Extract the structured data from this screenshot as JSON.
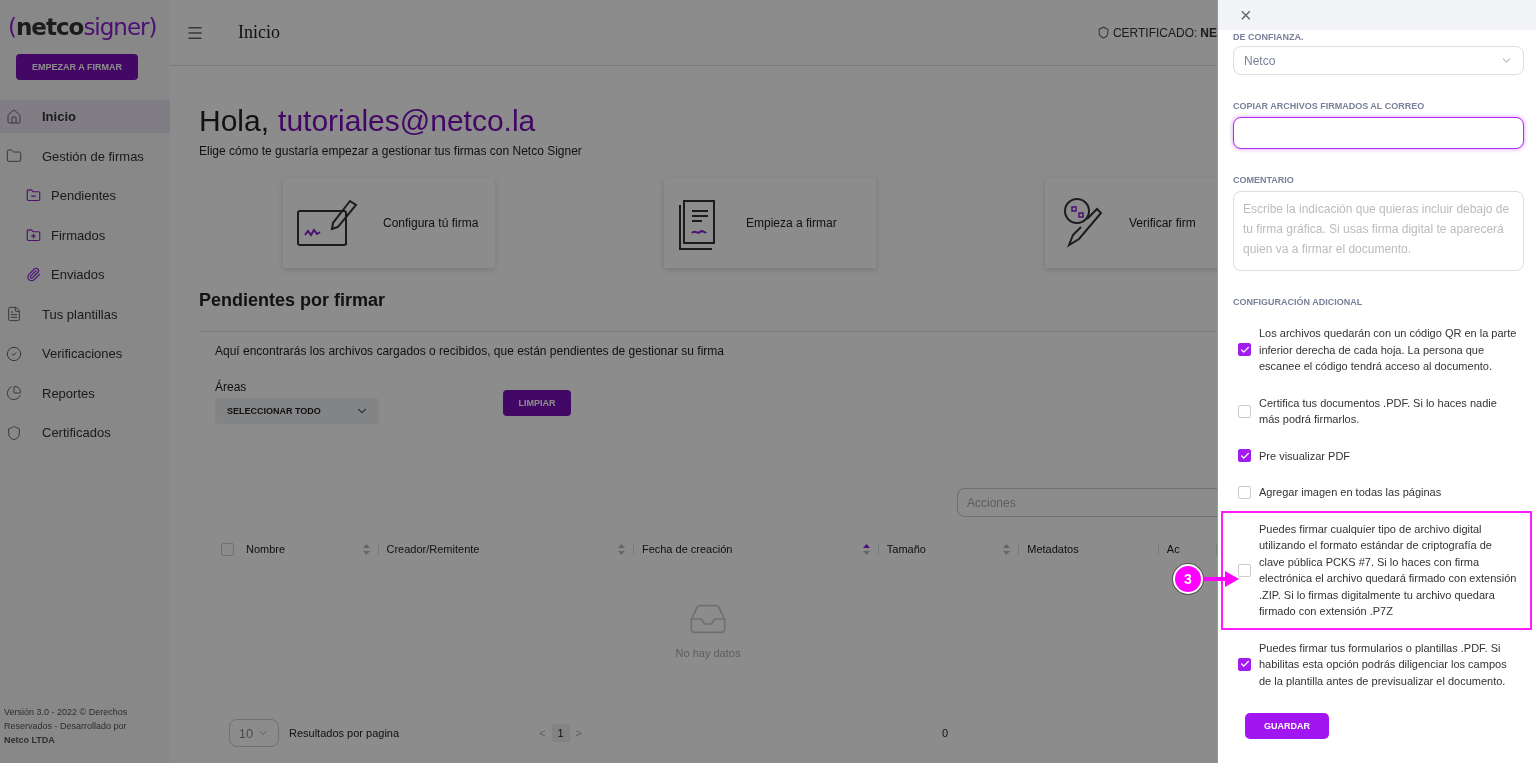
{
  "sidebar": {
    "logo": [
      {
        "text": "(",
        "accent": true
      },
      {
        "text": "netco",
        "accent": false
      },
      {
        "text": "signer",
        "accent": true
      },
      {
        "text": ")",
        "accent": true
      }
    ],
    "start_button": "EMPEZAR A FIRMAR",
    "items": [
      {
        "label": "Inicio",
        "selected": true
      },
      {
        "label": "Gestión de firmas",
        "selected": false,
        "children": [
          {
            "label": "Pendientes",
            "selected": false
          },
          {
            "label": "Firmados",
            "selected": false
          },
          {
            "label": "Enviados",
            "selected": false
          }
        ]
      },
      {
        "label": "Tus plantillas",
        "selected": false
      },
      {
        "label": "Verificaciones",
        "selected": false
      },
      {
        "label": "Reportes",
        "selected": false
      },
      {
        "label": "Certificados",
        "selected": false
      }
    ],
    "footer": "Versión 3.0 - 2022 © Derechos Reservados - Desarrollado por **Netco LTDA**"
  },
  "header": {
    "title": "Inicio",
    "certificate_label": "CERTIFICADO:",
    "certificate_value": "NE"
  },
  "greeting": {
    "prefix": "Hola,",
    "email": "tutoriales@netco.la",
    "subtitle": "Elige cómo te gustaría empezar a gestionar tus firmas con Netco Signer"
  },
  "cards": [
    {
      "label": "Configura tú firma"
    },
    {
      "label": "Empieza a firmar"
    },
    {
      "label": "Verificar firm"
    }
  ],
  "pending": {
    "title": "Pendientes por firmar",
    "description": "Aquí encontrarás los archivos cargados o recibidos, que están pendientes de gestionar su firma",
    "areas_label": "Áreas",
    "areas_value": "SELECCIONAR TODO",
    "clear_button": "LIMPIAR",
    "actions_placeholder": "Acciones",
    "select_all_checked": false,
    "columns": [
      {
        "label": "Nombre",
        "sortable": true,
        "sorted": false
      },
      {
        "label": "Creador/Remitente",
        "sortable": true,
        "sorted": false
      },
      {
        "label": "Fecha de creación",
        "sortable": true,
        "sorted": true
      },
      {
        "label": "Tamaño",
        "sortable": true,
        "sorted": false
      },
      {
        "label": "Metadatos",
        "sortable": false
      },
      {
        "label": "Ac",
        "sortable": false
      }
    ],
    "empty_text": "No hay datos",
    "page_size": "10",
    "page_size_label": "Resultados por pagina",
    "prev": "<",
    "page": "1",
    "next": ">",
    "total": "0"
  },
  "drawer": {
    "close": "×",
    "trust_label": "DE CONFIANZA.",
    "trust_value": "Netco",
    "copy_label": "COPIAR ARCHIVOS FIRMADOS AL CORREO",
    "copy_focused": true,
    "comment_label": "COMENTARIO",
    "comment_placeholder": "Escribe la indicación que quieras incluir debajo de tu firma gráfica. Si usas firma digital te aparecerá quien va a firmar el documento.",
    "extra_label": "CONFIGURACIÓN ADICIONAL",
    "options": [
      {
        "kind": "checkbox",
        "text": "Los archivos quedarán con un código QR en la parte inferior derecha de cada hoja. La persona que escanee el código tendrá acceso al documento.",
        "checked": true,
        "highlighted": false
      },
      {
        "kind": "checkbox",
        "text": "Certifica tus documentos .PDF. Si lo haces nadie más podrá firmarlos.",
        "checked": false,
        "highlighted": false
      },
      {
        "kind": "checkbox",
        "text": "Pre visualizar PDF",
        "checked": true,
        "highlighted": false
      },
      {
        "kind": "checkbox",
        "text": "Agregar imagen en todas las páginas",
        "checked": false,
        "highlighted": false
      },
      {
        "kind": "checkbox",
        "text": "Puedes firmar cualquier tipo de archivo digital utilizando el formato estándar de criptografía de clave pública PCKS #7. Si lo haces con firma electrónica el archivo quedará firmado con extensión .ZIP. Si lo firmas digitalmente tu archivo quedara firmado con extensión .P7Z",
        "checked": false,
        "highlighted": true
      },
      {
        "kind": "checkbox",
        "text": "Puedes firmar tus formularios o plantillas .PDF. Si habilitas esta opción podrás diligenciar los campos de la plantilla antes de previsualizar el documento.",
        "checked": true,
        "highlighted": false
      }
    ],
    "save_button": "GUARDAR",
    "step_badge": "3"
  }
}
